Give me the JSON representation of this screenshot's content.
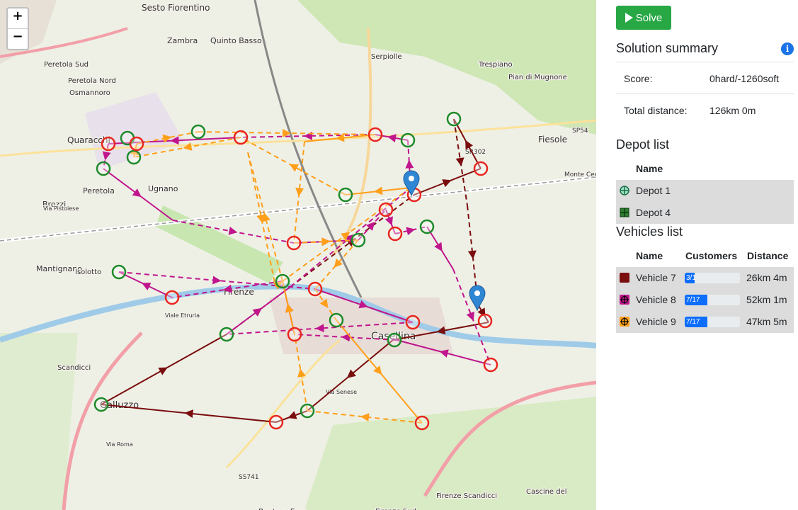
{
  "map": {
    "zoom_in": "+",
    "zoom_out": "−",
    "place_labels": [
      "Sesto Fiorentino",
      "Zambra",
      "Quinto Basso",
      "Serpiolle",
      "Trespiano",
      "Pian di Mugnone",
      "Fiesole",
      "Peretola Sud",
      "Peretola Nord",
      "Osmannoro",
      "Quaracchi",
      "Peretola",
      "Brozzi",
      "Ugnano",
      "Mantignano",
      "Isolotto",
      "Firenze",
      "Casellina",
      "Scandicci",
      "Galluzzo",
      "Ponte a Ema",
      "Cascine del",
      "Firenze Sud",
      "Firenze Scandicci",
      "SP54",
      "SR302",
      "SS741",
      "Monte Ceceri",
      "Via Pistoiese",
      "Viale Etruria",
      "Via Roma",
      "Via Senese"
    ],
    "route_colors": {
      "vehicle7": "#7a0d0d",
      "vehicle8": "#c0158c",
      "vehicle9": "#ff9f1a"
    }
  },
  "panel": {
    "solve_label": "Solve",
    "summary_title": "Solution summary",
    "info_icon": "i",
    "score_label": "Score:",
    "score_value": "0hard/-1260soft",
    "distance_label": "Total distance:",
    "distance_value": "126km 0m",
    "depot_title": "Depot list",
    "depot_col_name": "Name",
    "depots": [
      {
        "name": "Depot 1",
        "icon": "crosshair-icon"
      },
      {
        "name": "Depot 4",
        "icon": "crosshair-icon"
      }
    ],
    "vehicles_title": "Vehicles list",
    "vehicle_cols": {
      "name": "Name",
      "customers": "Customers",
      "distance": "Distance"
    },
    "vehicles": [
      {
        "name": "Vehicle 7",
        "customers": "3/1",
        "load_fraction": 0.18,
        "distance": "26km 4m",
        "color": "#7a0d0d"
      },
      {
        "name": "Vehicle 8",
        "customers": "7/17",
        "load_fraction": 0.41,
        "distance": "52km 1m",
        "color": "#c0158c"
      },
      {
        "name": "Vehicle 9",
        "customers": "7/17",
        "load_fraction": 0.41,
        "distance": "47km 5m",
        "color": "#ff9f1a"
      }
    ]
  }
}
